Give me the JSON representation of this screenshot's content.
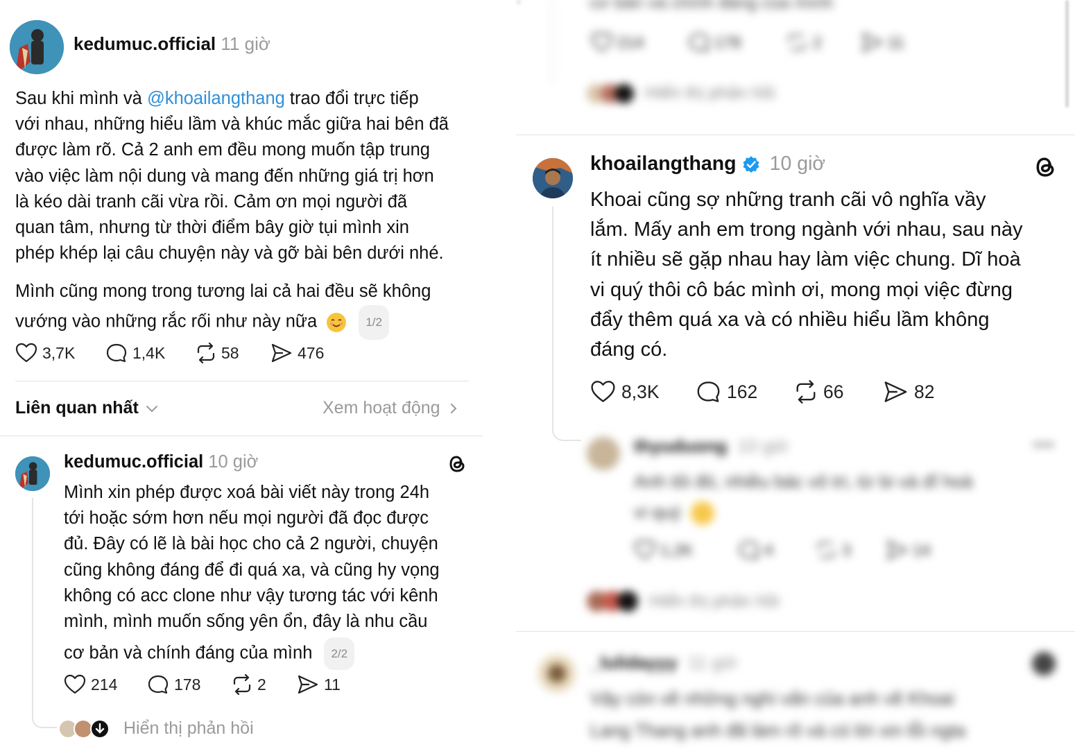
{
  "left": {
    "post": {
      "username": "kedumuc.official",
      "time": "11 giờ",
      "text_before_mention": "Sau khi mình và ",
      "mention": "@khoailangthang",
      "line1_rest": " trao đổi trực tiếp",
      "lines": [
        "với nhau, những hiểu lầm và khúc mắc giữa hai bên đã",
        "được làm rõ. Cả 2 anh em đều mong muốn tập trung",
        "vào việc làm nội dung và mang đến những giá trị hơn",
        "là kéo dài tranh cãi vừa rồi. Cảm ơn mọi người đã",
        "quan tâm, nhưng từ thời điểm bây giờ tụi mình xin",
        "phép khép lại câu chuyện này và gỡ bài bên dưới nhé."
      ],
      "para2_line1": "Mình cũng mong trong tương lai cả hai  đều sẽ không",
      "para2_line2": "vướng vào những rắc rối như này nữa",
      "emoji": "☺️",
      "pager": "1/2",
      "likes": "3,7K",
      "comments": "1,4K",
      "reposts": "58",
      "shares": "476"
    },
    "sort": {
      "label": "Liên quan nhất",
      "activity": "Xem hoạt động"
    },
    "reply": {
      "username": "kedumuc.official",
      "time": "10 giờ",
      "lines": [
        "Mình xin phép được xoá bài viết này trong 24h",
        "tới hoặc sớm hơn nếu mọi người đã đọc được",
        "đủ. Đây có lẽ là bài học cho cả 2 người, chuyện",
        "cũng không đáng để đi quá xa, và cũng hy vọng",
        "không có acc clone như vậy tương tác với kênh",
        "mình, mình muốn sống yên ổn, đây là nhu cầu"
      ],
      "last_line": "cơ bản và chính đáng của mình",
      "pager": "2/2",
      "likes": "214",
      "comments": "178",
      "reposts": "2",
      "shares": "11",
      "show_replies": "Hiển thị phản hồi"
    }
  },
  "right": {
    "top_blurred": {
      "text": "cơ bản và chính đáng của mình",
      "likes": "214",
      "comments": "178",
      "reposts": "2",
      "shares": "11",
      "show_replies": "Hiển thị phản hồi"
    },
    "post": {
      "username": "khoailangthang",
      "time": "10 giờ",
      "lines": [
        "Khoai cũng sợ những tranh cãi vô nghĩa vầy",
        "lắm. Mấy anh em trong ngành với nhau, sau này",
        "ít nhiều sẽ gặp nhau hay làm việc chung. Dĩ hoà",
        "vi quý thôi cô bác mình ơi, mong mọi việc đừng",
        "đẩy thêm quá xa và có nhiều hiểu lầm không",
        "đáng có."
      ],
      "likes": "8,3K",
      "comments": "162",
      "reposts": "66",
      "shares": "82"
    },
    "blurred_reply": {
      "username": "thyuduong",
      "time": "10 giờ",
      "line1": "Anh tôi đó, nhiều bác vô tri, từ bi và dĩ hoà",
      "line2": "vi quý",
      "likes": "1,2K",
      "comments": "4",
      "reposts": "3",
      "shares": "14",
      "show_replies": "Hiển thị phản hồi"
    },
    "blurred_post2": {
      "username": "_lulidayyy",
      "time": "11 giờ",
      "line1": "Vậy còn về những nghi vấn của anh về Khoai",
      "line2": "Lang Thang anh đã làm rõ và có lời xin lỗi ngta"
    }
  },
  "colors": {
    "mention": "#2f8fd8",
    "verified": "#1d9bf0",
    "muted": "#9a9a9a"
  }
}
